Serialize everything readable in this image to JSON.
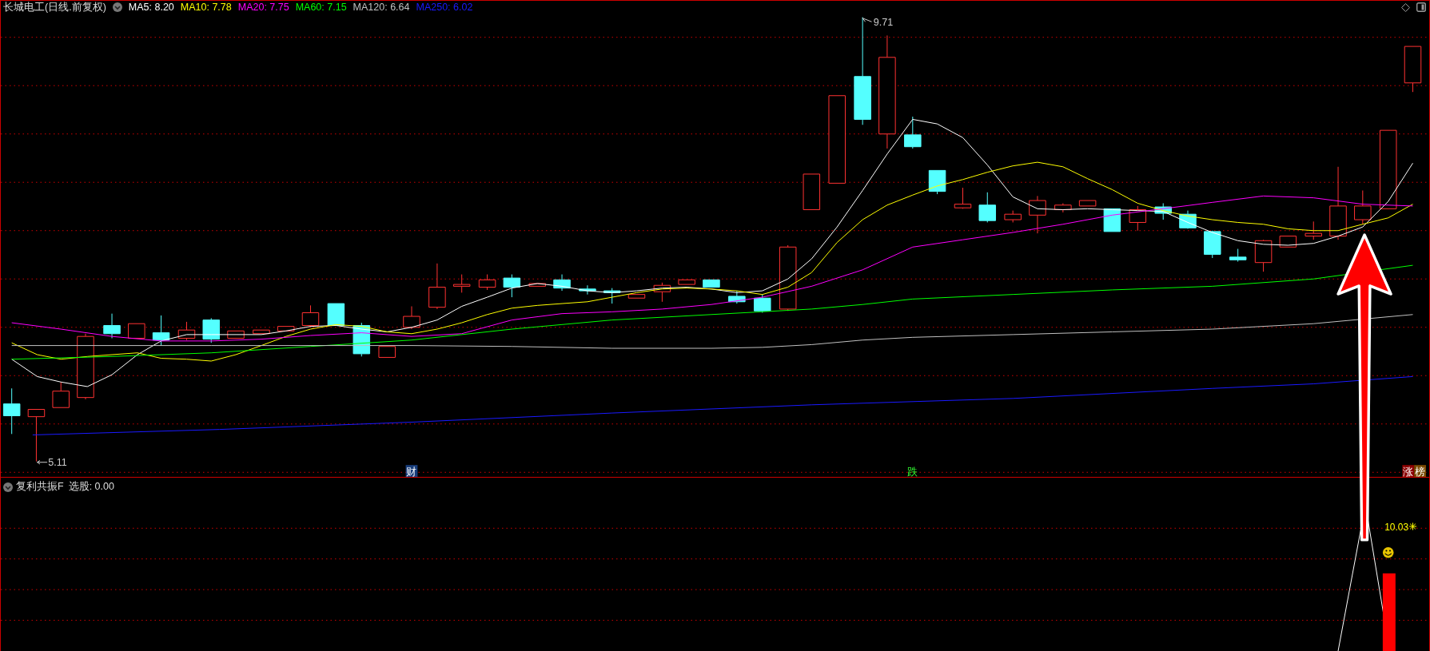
{
  "chart": {
    "title": "长城电工(日线.前复权)",
    "ma_legend": [
      {
        "text": "MA5: 8.20",
        "color": "#ffffff"
      },
      {
        "text": "MA10: 7.78",
        "color": "#ffff00"
      },
      {
        "text": "MA20: 7.75",
        "color": "#ff00ff"
      },
      {
        "text": "MA60: 7.15",
        "color": "#00ff00"
      },
      {
        "text": "MA120: 6.64",
        "color": "#c0c0c0"
      },
      {
        "text": "MA250: 6.02",
        "color": "#1a1aff"
      }
    ],
    "high_label": "9.71",
    "low_label": "5.11",
    "event_tags": [
      {
        "text": "财",
        "kind": "finance"
      },
      {
        "text": "跌",
        "kind": "drop"
      },
      {
        "text": "涨",
        "kind": "rise"
      },
      {
        "text": "榜",
        "kind": "list"
      }
    ]
  },
  "indicator": {
    "name": "复利共振F",
    "reading": "选股: 0.00",
    "value_label": "10.03"
  }
}
